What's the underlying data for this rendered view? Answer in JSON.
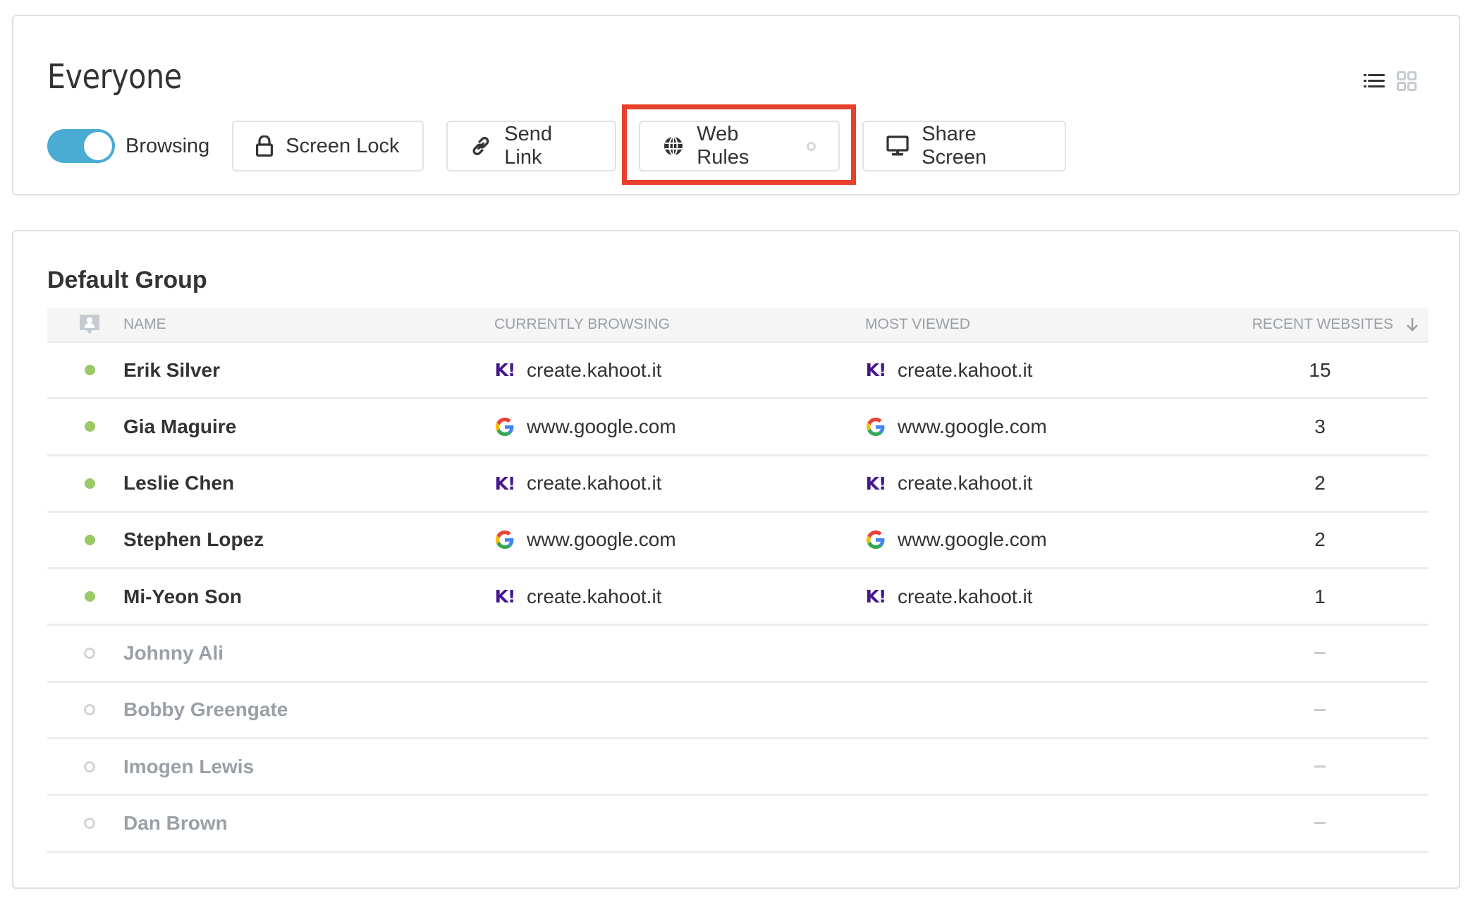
{
  "header": {
    "title": "Everyone",
    "view_icons": [
      {
        "name": "list-view-icon",
        "active": true
      },
      {
        "name": "grid-view-icon",
        "active": false
      }
    ]
  },
  "toolbar": {
    "toggle": {
      "label": "Browsing",
      "on": true,
      "color": "#4aabd3"
    },
    "buttons": [
      {
        "id": "screen-lock",
        "label": "Screen Lock",
        "icon": "lock-icon"
      },
      {
        "id": "send-link",
        "label": "Send Link",
        "icon": "link-icon"
      },
      {
        "id": "web-rules",
        "label": "Web Rules",
        "icon": "globe-icon",
        "status": "inactive",
        "highlighted": true
      },
      {
        "id": "share-screen",
        "label": "Share Screen",
        "icon": "monitor-icon"
      }
    ],
    "highlight_color": "#e8402a"
  },
  "group": {
    "title": "Default Group",
    "columns": {
      "icon": "person-icon",
      "name": "NAME",
      "currently_browsing": "CURRENTLY BROWSING",
      "most_viewed": "MOST VIEWED",
      "recent_websites": "RECENT WEBSITES",
      "sort": "descending"
    },
    "rows": [
      {
        "name": "Erik Silver",
        "online": true,
        "current": {
          "site": "create.kahoot.it",
          "icon": "kahoot"
        },
        "most": {
          "site": "create.kahoot.it",
          "icon": "kahoot"
        },
        "recent": "15"
      },
      {
        "name": "Gia Maguire",
        "online": true,
        "current": {
          "site": "www.google.com",
          "icon": "google"
        },
        "most": {
          "site": "www.google.com",
          "icon": "google"
        },
        "recent": "3"
      },
      {
        "name": "Leslie Chen",
        "online": true,
        "current": {
          "site": "create.kahoot.it",
          "icon": "kahoot"
        },
        "most": {
          "site": "create.kahoot.it",
          "icon": "kahoot"
        },
        "recent": "2"
      },
      {
        "name": "Stephen Lopez",
        "online": true,
        "current": {
          "site": "www.google.com",
          "icon": "google"
        },
        "most": {
          "site": "www.google.com",
          "icon": "google"
        },
        "recent": "2"
      },
      {
        "name": "Mi-Yeon Son",
        "online": true,
        "current": {
          "site": "create.kahoot.it",
          "icon": "kahoot"
        },
        "most": {
          "site": "create.kahoot.it",
          "icon": "kahoot"
        },
        "recent": "1"
      },
      {
        "name": "Johnny Ali",
        "online": false,
        "current": null,
        "most": null,
        "recent": "–"
      },
      {
        "name": "Bobby Greengate",
        "online": false,
        "current": null,
        "most": null,
        "recent": "–"
      },
      {
        "name": "Imogen Lewis",
        "online": false,
        "current": null,
        "most": null,
        "recent": "–"
      },
      {
        "name": "Dan Brown",
        "online": false,
        "current": null,
        "most": null,
        "recent": "–"
      }
    ]
  },
  "colors": {
    "online": "#9bc967",
    "offline": "#d4d4d4",
    "kahoot": "#46178f",
    "muted_text": "#9aa0a6"
  }
}
